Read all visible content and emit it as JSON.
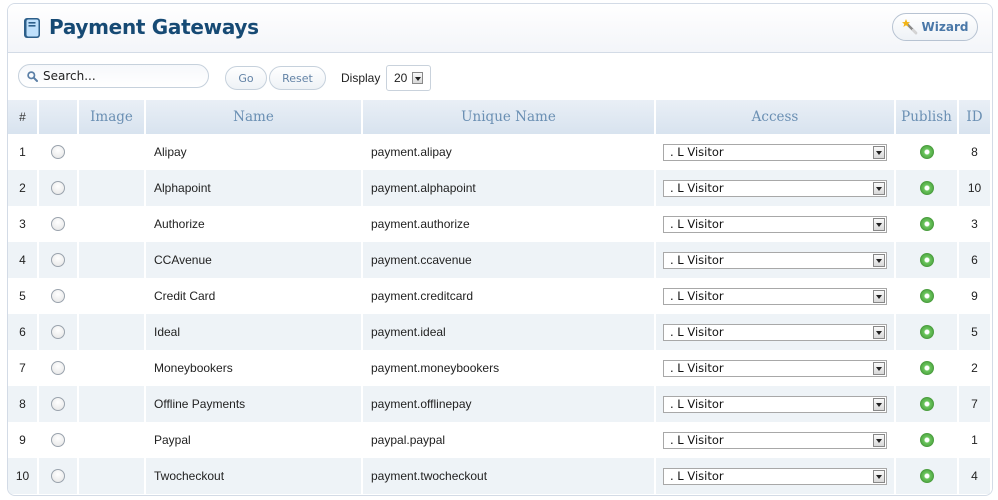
{
  "header": {
    "title": "Payment Gateways",
    "title_icon": "book-icon",
    "wizard_label": "Wizard",
    "wizard_icon": "magic-wand-icon"
  },
  "toolbar": {
    "search_placeholder": "Search...",
    "search_value": "",
    "search_icon": "search-icon",
    "go_label": "Go",
    "reset_label": "Reset",
    "display_label": "Display",
    "display_value": "20"
  },
  "table": {
    "columns": [
      "#",
      "",
      "Image",
      "Name",
      "Unique Name",
      "Access",
      "Publish",
      "ID"
    ],
    "rows": [
      {
        "num": "1",
        "name": "Alipay",
        "unique_name": "payment.alipay",
        "access": ".  L Visitor",
        "published": true,
        "id": "8"
      },
      {
        "num": "2",
        "name": "Alphapoint",
        "unique_name": "payment.alphapoint",
        "access": ".  L Visitor",
        "published": true,
        "id": "10"
      },
      {
        "num": "3",
        "name": "Authorize",
        "unique_name": "payment.authorize",
        "access": ".  L Visitor",
        "published": true,
        "id": "3"
      },
      {
        "num": "4",
        "name": "CCAvenue",
        "unique_name": "payment.ccavenue",
        "access": ".  L Visitor",
        "published": true,
        "id": "6"
      },
      {
        "num": "5",
        "name": "Credit Card",
        "unique_name": "payment.creditcard",
        "access": ".  L Visitor",
        "published": true,
        "id": "9"
      },
      {
        "num": "6",
        "name": "Ideal",
        "unique_name": "payment.ideal",
        "access": ".  L Visitor",
        "published": true,
        "id": "5"
      },
      {
        "num": "7",
        "name": "Moneybookers",
        "unique_name": "payment.moneybookers",
        "access": ".  L Visitor",
        "published": true,
        "id": "2"
      },
      {
        "num": "8",
        "name": "Offline Payments",
        "unique_name": "payment.offlinepay",
        "access": ".  L Visitor",
        "published": true,
        "id": "7"
      },
      {
        "num": "9",
        "name": "Paypal",
        "unique_name": "paypal.paypal",
        "access": ".  L Visitor",
        "published": true,
        "id": "1"
      },
      {
        "num": "10",
        "name": "Twocheckout",
        "unique_name": "payment.twocheckout",
        "access": ".  L Visitor",
        "published": true,
        "id": "4"
      }
    ]
  },
  "colors": {
    "title": "#164a74",
    "header_text": "#6a8fb3",
    "stripe": "#eef3f7",
    "publish_green": "#5cb84f"
  }
}
